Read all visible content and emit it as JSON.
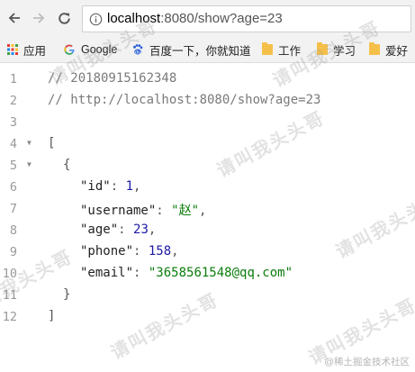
{
  "toolbar": {
    "back_icon": "arrow-left-icon",
    "forward_icon": "arrow-right-icon",
    "reload_icon": "reload-icon",
    "info_icon": "info-icon",
    "url_host": "localhost",
    "url_rest": ":8080/show?age=23"
  },
  "bookmarks": {
    "apps_label": "应用",
    "items": [
      {
        "label": "Google",
        "icon": "google-icon"
      },
      {
        "label": "百度一下，你就知道",
        "icon": "baidu-paw-icon"
      },
      {
        "label": "工作",
        "icon": "folder-icon"
      },
      {
        "label": "学习",
        "icon": "folder-icon"
      },
      {
        "label": "爱好",
        "icon": "folder-icon"
      }
    ]
  },
  "code": {
    "line_numbers": [
      "1",
      "2",
      "3",
      "4",
      "5",
      "6",
      "7",
      "8",
      "9",
      "10",
      "11",
      "12"
    ],
    "comment_date": "// 20180915162348",
    "comment_url": "// http://localhost:8080/show?age=23",
    "open_bracket": "[",
    "open_brace": "{",
    "fields": [
      {
        "key": "\"id\"",
        "value": "1",
        "kind": "num",
        "trail": ","
      },
      {
        "key": "\"username\"",
        "value": "\"赵\"",
        "kind": "str",
        "trail": ","
      },
      {
        "key": "\"age\"",
        "value": "23",
        "kind": "num",
        "trail": ","
      },
      {
        "key": "\"phone\"",
        "value": "158",
        "kind": "num",
        "trail": ","
      },
      {
        "key": "\"email\"",
        "value": "\"3658561548@qq.com\"",
        "kind": "str",
        "trail": ""
      }
    ],
    "close_brace": "}",
    "close_bracket": "]"
  },
  "watermark": {
    "text": "请叫我头头哥",
    "credit": "@稀土掘金技术社区"
  },
  "colors": {
    "number": "#1c1aa3",
    "string": "#0b7d0b",
    "comment": "#7a7a7a"
  }
}
